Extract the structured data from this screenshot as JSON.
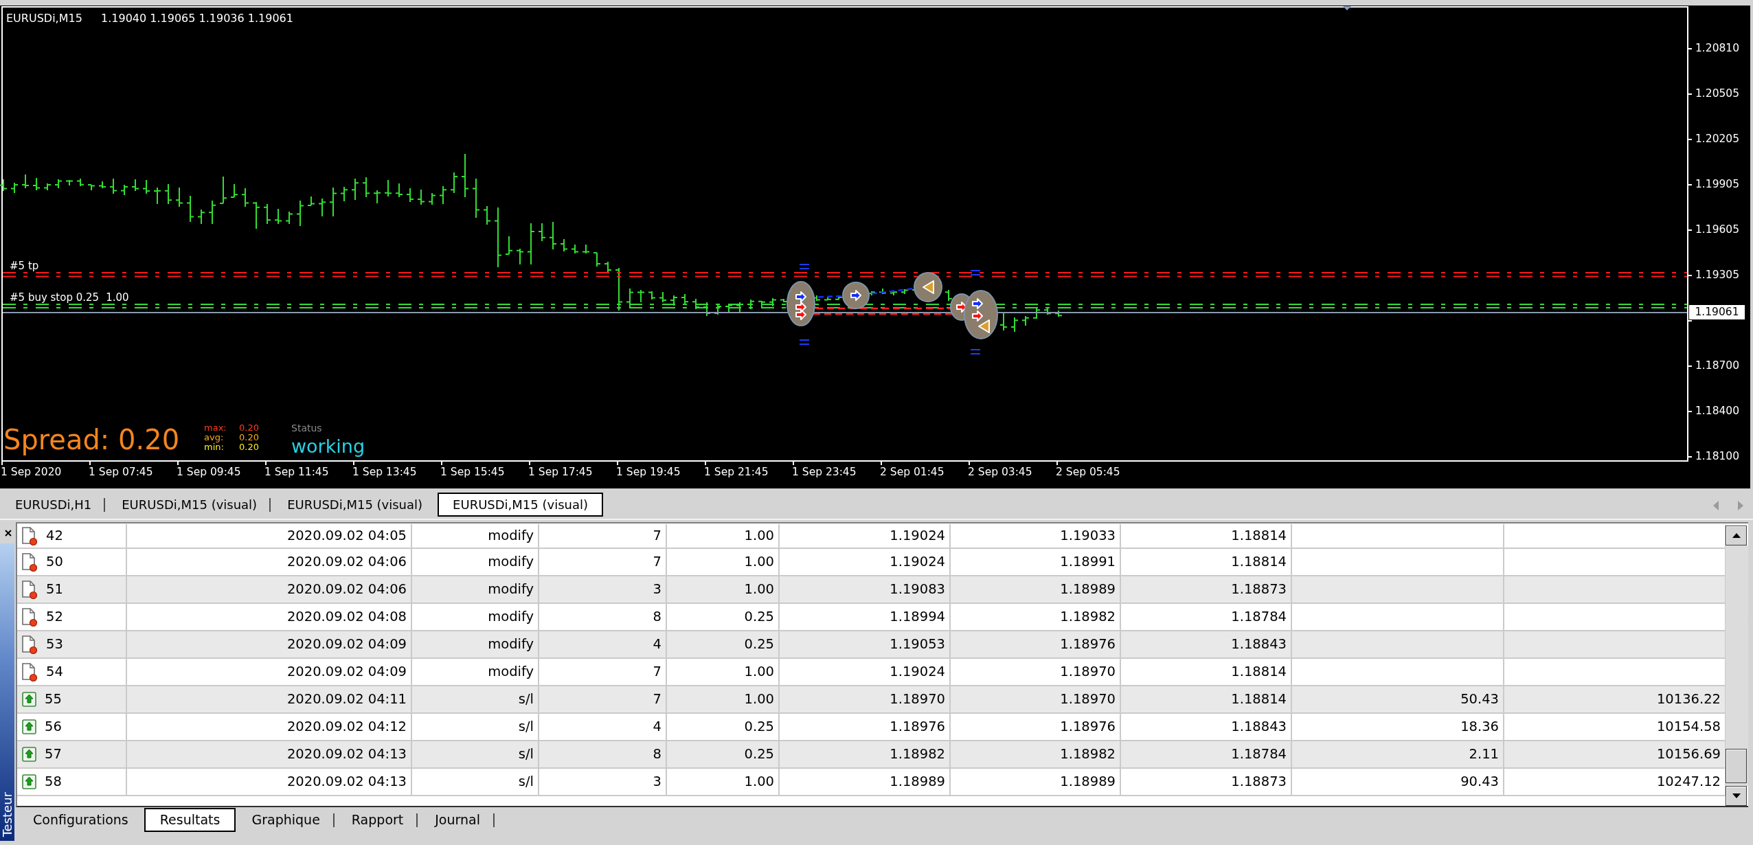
{
  "chart": {
    "symbol": "EURUSDi,M15",
    "quotes": "1.19040 1.19065 1.19036 1.19061",
    "price_axis": [
      "1.20810",
      "1.20505",
      "1.20205",
      "1.19905",
      "1.19605",
      "1.19305",
      "1.18700",
      "1.18400",
      "1.18100"
    ],
    "current_price": "1.19061",
    "time_axis": [
      "1 Sep 2020",
      "1 Sep 07:45",
      "1 Sep 09:45",
      "1 Sep 11:45",
      "1 Sep 13:45",
      "1 Sep 15:45",
      "1 Sep 17:45",
      "1 Sep 19:45",
      "1 Sep 21:45",
      "1 Sep 23:45",
      "2 Sep 01:45",
      "2 Sep 03:45",
      "2 Sep 05:45"
    ],
    "order_labels": [
      {
        "kind": "take_profit",
        "text": "#5 tp"
      },
      {
        "kind": "buy_stop",
        "text": "#5 buy stop 0.25"
      },
      {
        "kind": "buy_stop",
        "text": "1.00"
      }
    ],
    "spread": {
      "title": "Spread: 0.20",
      "stats": [
        {
          "label": "max:",
          "value": "0.20",
          "color": "#ff3c1e"
        },
        {
          "label": "avg:",
          "value": "0.20",
          "color": "#ffaa1e"
        },
        {
          "label": "min:",
          "value": "0.20",
          "color": "#fff01e"
        }
      ],
      "status_label": "Status",
      "status": "working"
    }
  },
  "chart_tabs": [
    {
      "label": "EURUSDi,H1",
      "selected": false
    },
    {
      "label": "EURUSDi,M15 (visual)",
      "selected": false
    },
    {
      "label": "EURUSDi,M15 (visual)",
      "selected": false
    },
    {
      "label": "EURUSDi,M15 (visual)",
      "selected": true
    }
  ],
  "tester": {
    "title": "Testeur",
    "rows": [
      {
        "kind": "modify",
        "shaded": false,
        "cells": [
          "42",
          "2020.09.02 04:05",
          "modify",
          "7",
          "1.00",
          "1.19024",
          "1.19033",
          "1.18814"
        ]
      },
      {
        "kind": "modify",
        "shaded": false,
        "cells": [
          "50",
          "2020.09.02 04:06",
          "modify",
          "7",
          "1.00",
          "1.19024",
          "1.18991",
          "1.18814"
        ]
      },
      {
        "kind": "modify",
        "shaded": true,
        "cells": [
          "51",
          "2020.09.02 04:06",
          "modify",
          "3",
          "1.00",
          "1.19083",
          "1.18989",
          "1.18873"
        ]
      },
      {
        "kind": "modify",
        "shaded": false,
        "cells": [
          "52",
          "2020.09.02 04:08",
          "modify",
          "8",
          "0.25",
          "1.18994",
          "1.18982",
          "1.18784"
        ]
      },
      {
        "kind": "modify",
        "shaded": true,
        "cells": [
          "53",
          "2020.09.02 04:09",
          "modify",
          "4",
          "0.25",
          "1.19053",
          "1.18976",
          "1.18843"
        ]
      },
      {
        "kind": "modify",
        "shaded": false,
        "cells": [
          "54",
          "2020.09.02 04:09",
          "modify",
          "7",
          "1.00",
          "1.19024",
          "1.18970",
          "1.18814"
        ]
      },
      {
        "kind": "close",
        "shaded": true,
        "cells": [
          "55",
          "2020.09.02 04:11",
          "s/l",
          "7",
          "1.00",
          "1.18970",
          "1.18970",
          "1.18814",
          "50.43",
          "10136.22"
        ]
      },
      {
        "kind": "close",
        "shaded": false,
        "cells": [
          "56",
          "2020.09.02 04:12",
          "s/l",
          "4",
          "0.25",
          "1.18976",
          "1.18976",
          "1.18843",
          "18.36",
          "10154.58"
        ]
      },
      {
        "kind": "close",
        "shaded": true,
        "cells": [
          "57",
          "2020.09.02 04:13",
          "s/l",
          "8",
          "0.25",
          "1.18982",
          "1.18982",
          "1.18784",
          "2.11",
          "10156.69"
        ]
      },
      {
        "kind": "close",
        "shaded": false,
        "cells": [
          "58",
          "2020.09.02 04:13",
          "s/l",
          "3",
          "1.00",
          "1.18989",
          "1.18989",
          "1.18873",
          "90.43",
          "10247.12"
        ]
      }
    ],
    "tabs": [
      {
        "label": "Configurations",
        "selected": false
      },
      {
        "label": "Resultats",
        "selected": true
      },
      {
        "label": "Graphique",
        "selected": false
      },
      {
        "label": "Rapport",
        "selected": false
      },
      {
        "label": "Journal",
        "selected": false
      }
    ]
  }
}
